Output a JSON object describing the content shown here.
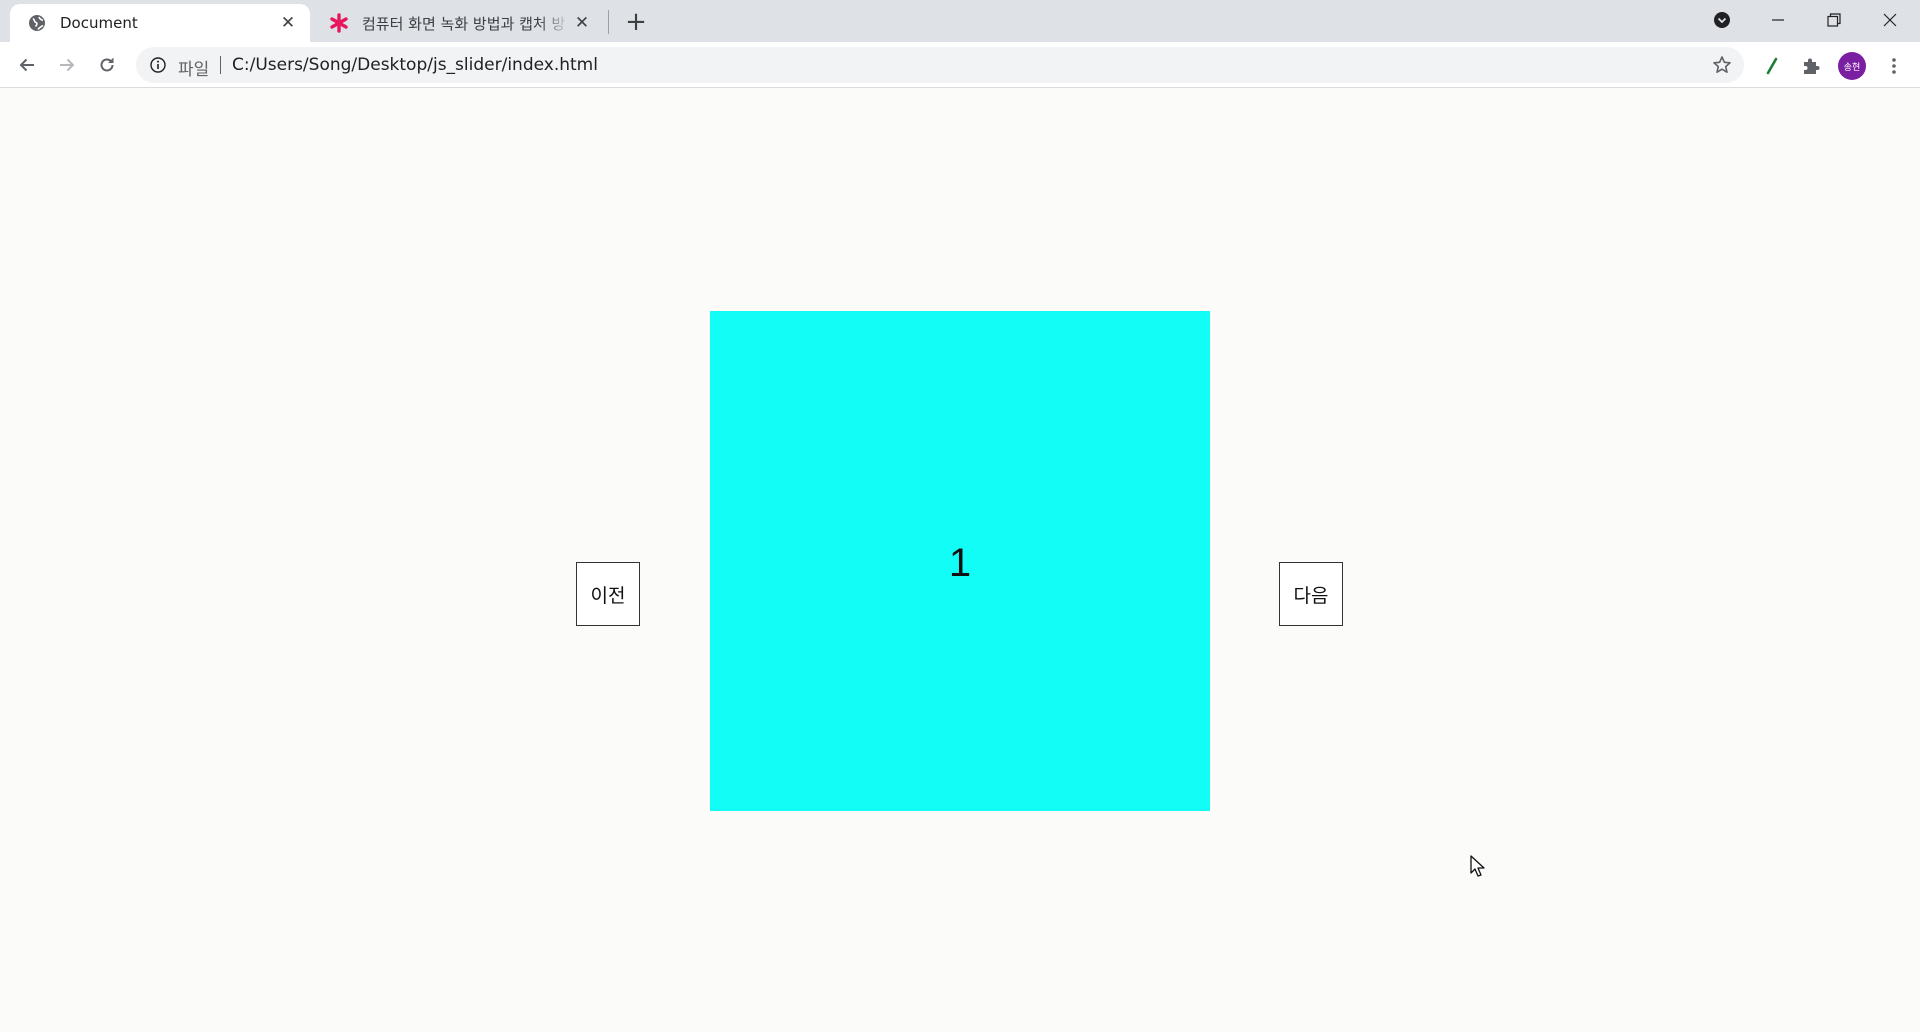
{
  "browser": {
    "tabs": [
      {
        "title": "Document",
        "active": true,
        "icon": "globe-icon"
      },
      {
        "title": "컴퓨터 화면 녹화 방법과 캡처 방",
        "active": false,
        "icon": "asterisk-icon"
      }
    ],
    "address_bar": {
      "scheme_label": "파일",
      "url": "C:/Users/Song/Desktop/js_slider/index.html"
    },
    "profile": {
      "initials": "송현",
      "color": "#7b1fa2"
    }
  },
  "slider": {
    "current_slide": "1",
    "slide_color": "#12fdf5",
    "prev_label": "이전",
    "next_label": "다음"
  }
}
